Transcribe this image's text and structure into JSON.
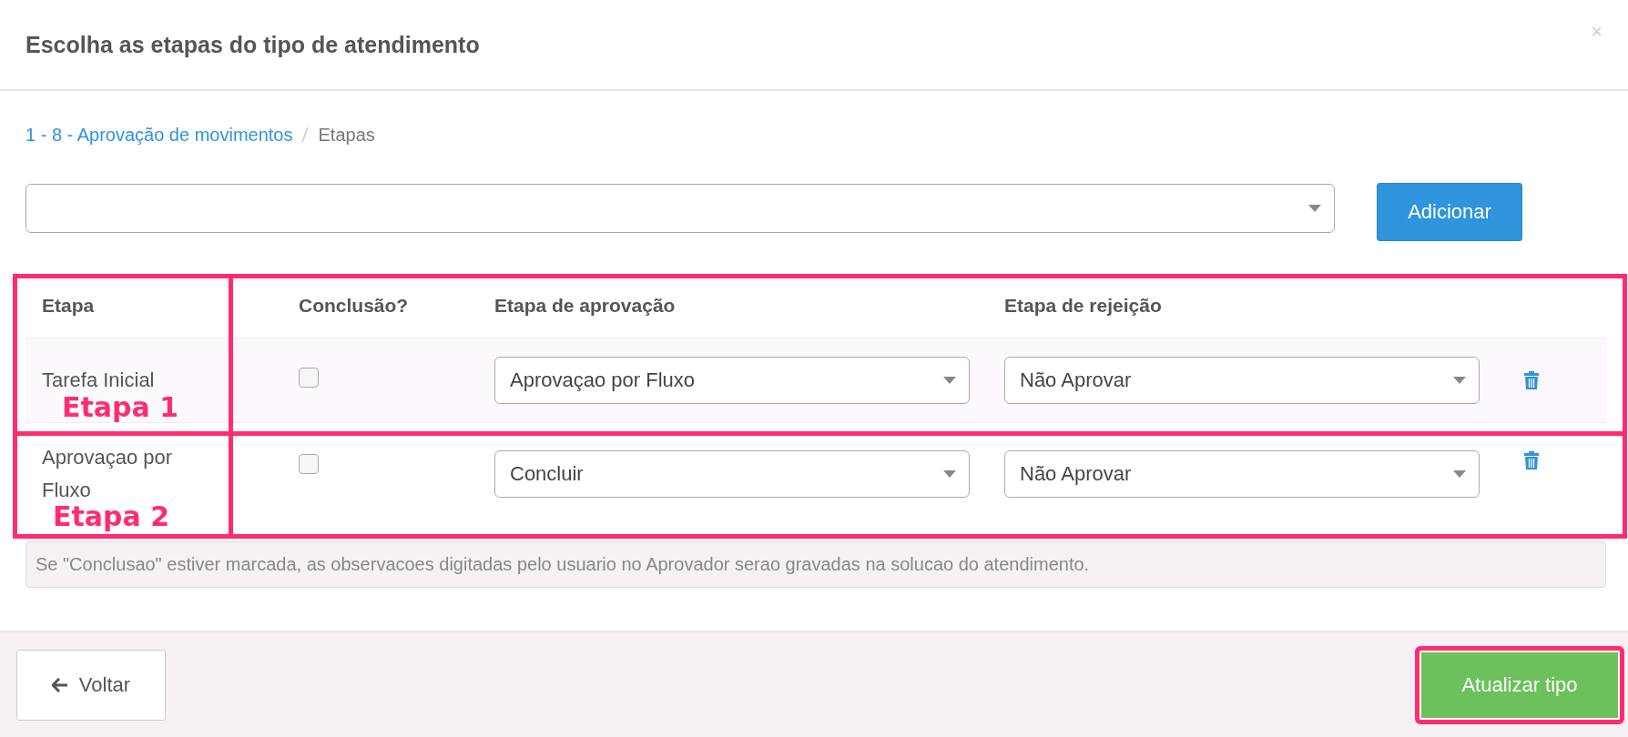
{
  "dialog": {
    "title": "Escolha as etapas do tipo de atendimento",
    "close": "×"
  },
  "breadcrumb": [
    {
      "label": "1 - 8 - Aprovação de movimentos",
      "kind": "link"
    },
    {
      "label": "Etapas",
      "kind": "current"
    }
  ],
  "add_row": {
    "button": "Adicionar"
  },
  "table": {
    "columns": [
      "Etapa",
      "Conclusão?",
      "Etapa de aprovação",
      "Etapa de rejeição"
    ],
    "rows": [
      {
        "etapa": "Tarefa Inicial",
        "checked": false,
        "aprovacao": "Aprovaçao por Fluxo",
        "rejeicao": "Não Aprovar",
        "annotation": "Etapa 1"
      },
      {
        "etapa": "Aprovaçao por Fluxo",
        "checked": false,
        "aprovacao": "Concluir",
        "rejeicao": "Não Aprovar",
        "annotation": "Etapa 2"
      }
    ]
  },
  "note": "Se \"Conclusao\" estiver marcada, as observacoes digitadas pelo usuario no Aprovador serao gravadas na solucao do atendimento.",
  "footer": {
    "back": "Voltar",
    "submit": {
      "label": "Atualizar tipo",
      "highlighted": true
    }
  }
}
